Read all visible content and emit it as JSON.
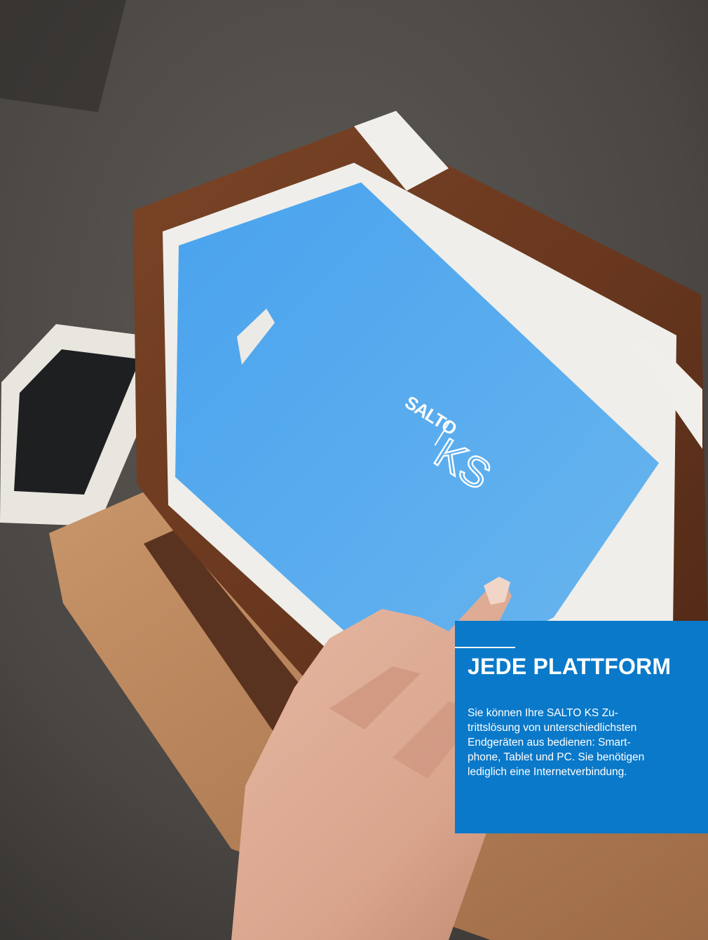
{
  "photo": {
    "subject": "hand tapping a tablet in a brown leather case showing the SALTO KS app, with a smartphone on the table",
    "screen_logo": {
      "brand": "SALTO",
      "product": "KS"
    },
    "colors": {
      "screen_blue": "#52a8ee",
      "leather_brown": "#6b3a20",
      "table_gray": "#4d4a47"
    }
  },
  "panel": {
    "background": "#0a79c9",
    "headline": "JEDE PLATTFORM",
    "body_lines": [
      "Sie können Ihre SALTO KS Zu-",
      "trittslösung von unterschiedlichsten",
      "Endgeräten aus bedienen: Smart-",
      "phone, Tablet und PC. Sie benötigen",
      "lediglich eine Internetverbindung."
    ]
  }
}
